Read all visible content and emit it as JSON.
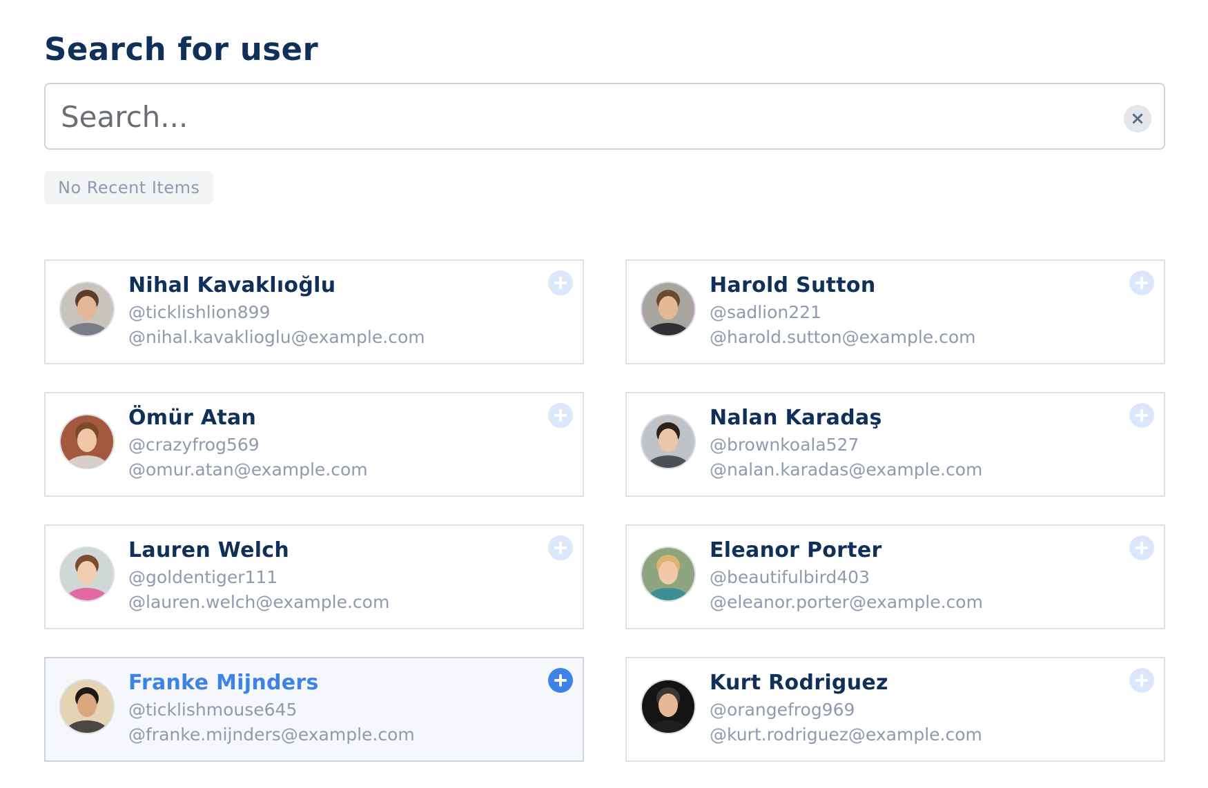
{
  "header": {
    "title": "Search for user"
  },
  "search": {
    "placeholder": "Search...",
    "value": "",
    "clear_label": "×"
  },
  "recent": {
    "label": "No Recent Items"
  },
  "users": [
    {
      "name": "Nihal Kavaklıoğlu",
      "handle": "@ticklishlion899",
      "email": "@nihal.kavaklioglu@example.com",
      "skin": "#e3b896",
      "hair": "#5a3d2b",
      "bg": "#c9c4bb",
      "shirt": "#7a7d85"
    },
    {
      "name": "Harold Sutton",
      "handle": "@sadlion221",
      "email": "@harold.sutton@example.com",
      "skin": "#e6b995",
      "hair": "#6b4a32",
      "bg": "#a9a6a0",
      "shirt": "#2f3133"
    },
    {
      "name": "Ömür Atan",
      "handle": "@crazyfrog569",
      "email": "@omur.atan@example.com",
      "skin": "#f0c7a8",
      "hair": "#7a4a2a",
      "bg": "#a4583d",
      "shirt": "#d8d0c8"
    },
    {
      "name": "Nalan Karadaş",
      "handle": "@brownkoala527",
      "email": "@nalan.karadas@example.com",
      "skin": "#edc6aa",
      "hair": "#2b211d",
      "bg": "#bfc2c6",
      "shirt": "#4b4f56"
    },
    {
      "name": "Lauren Welch",
      "handle": "@goldentiger111",
      "email": "@lauren.welch@example.com",
      "skin": "#f1cdb2",
      "hair": "#7b4c30",
      "bg": "#cfd8d5",
      "shirt": "#e06aa1"
    },
    {
      "name": "Eleanor Porter",
      "handle": "@beautifulbird403",
      "email": "@eleanor.porter@example.com",
      "skin": "#f1c9a9",
      "hair": "#d9b66b",
      "bg": "#8fa57f",
      "shirt": "#3e8f94"
    },
    {
      "name": "Franke Mijnders",
      "handle": "@ticklishmouse645",
      "email": "@franke.mijnders@example.com",
      "skin": "#d9a67f",
      "hair": "#1d1a18",
      "bg": "#e5d4b3",
      "shirt": "#4c4741"
    },
    {
      "name": "Kurt Rodriguez",
      "handle": "@orangefrog969",
      "email": "@kurt.rodriguez@example.com",
      "skin": "#e7b898",
      "hair": "#3c3631",
      "bg": "#141414",
      "shirt": "#1f1f22"
    }
  ]
}
